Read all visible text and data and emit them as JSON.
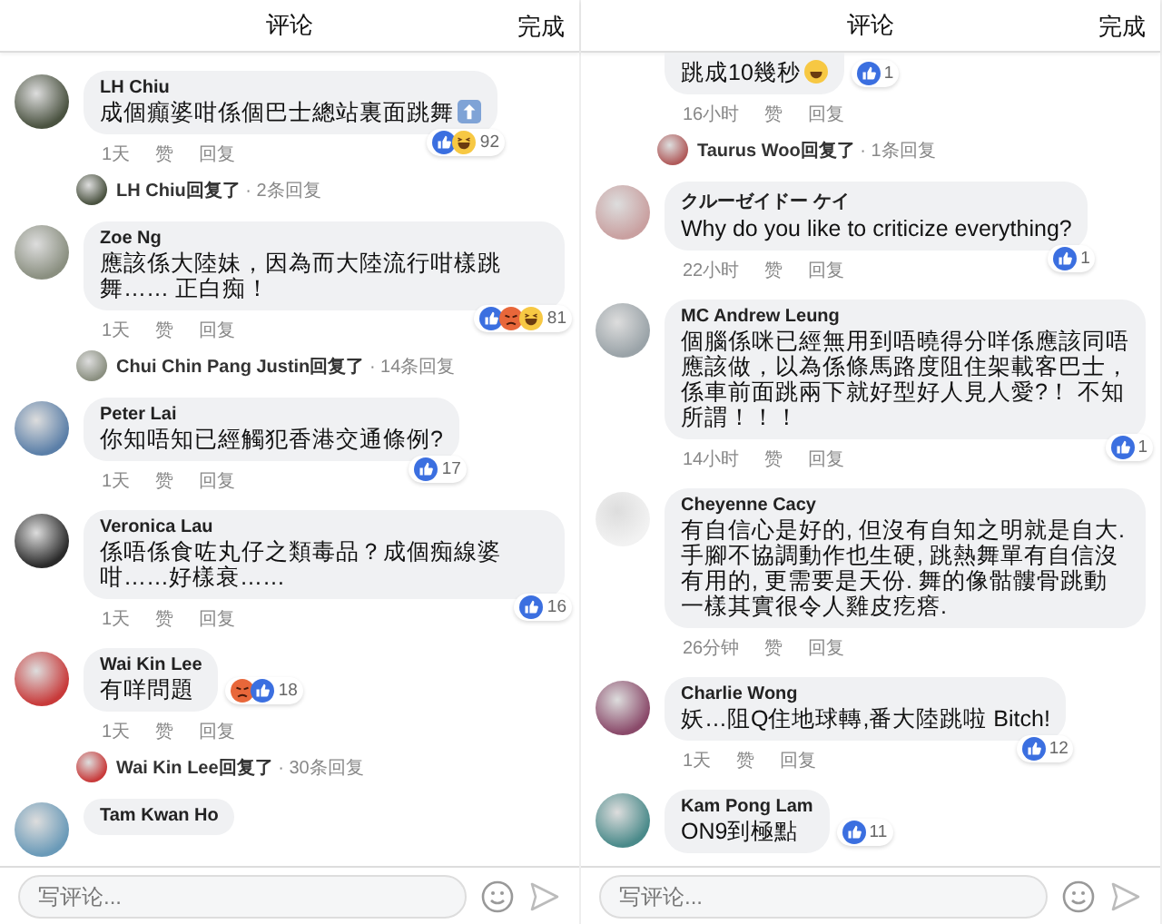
{
  "panels": [
    {
      "header": {
        "title": "评论",
        "done": "完成"
      },
      "comments": [
        {
          "author": "LH Chiu",
          "text": "成個癲婆咁係個巴士總站裏面跳舞",
          "emoji": {
            "kind": "arrow"
          },
          "time": "1天",
          "like": "赞",
          "reply": "回复",
          "reactions": [
            {
              "kind": "like"
            },
            {
              "kind": "haha"
            }
          ],
          "count": "92",
          "replies": "**LH Chiu回复了** · 2条回复"
        },
        {
          "author": "Zoe Ng",
          "text": "應該係大陸妹，因為而大陸流行咁樣跳舞…… 正白痴！",
          "time": "1天",
          "like": "赞",
          "reply": "回复",
          "reactions": [
            {
              "kind": "like"
            },
            {
              "kind": "angry"
            },
            {
              "kind": "haha"
            }
          ],
          "count": "81",
          "replies": "**Chui Chin Pang Justin回复了** · 14条回复"
        },
        {
          "author": "Peter Lai",
          "text": "你知唔知已經觸犯香港交通條例?",
          "time": "1天",
          "like": "赞",
          "reply": "回复",
          "reactions": [
            {
              "kind": "like"
            }
          ],
          "count": "17"
        },
        {
          "author": "Veronica Lau",
          "text": "係唔係食咗丸仔之類毒品？成個痴線婆咁……好樣衰……",
          "time": "1天",
          "like": "赞",
          "reply": "回复",
          "reactions": [
            {
              "kind": "like"
            }
          ],
          "count": "16"
        },
        {
          "author": "Wai Kin Lee",
          "text": "有咩問題",
          "time": "1天",
          "like": "赞",
          "reply": "回复",
          "reactions": [
            {
              "kind": "angry"
            },
            {
              "kind": "like"
            }
          ],
          "count": "18",
          "replies": "**Wai Kin Lee回复了** · 30条回复"
        },
        {
          "author": "Tam Kwan Ho"
        }
      ],
      "composer": {
        "placeholder": "写评论..."
      }
    },
    {
      "header": {
        "title": "评论",
        "done": "完成"
      },
      "comments": [
        {
          "text": "跳成10幾秒",
          "emoji": {
            "kind": "laugh"
          },
          "time": "16小时",
          "like": "赞",
          "reply": "回复",
          "reactions": [
            {
              "kind": "like"
            }
          ],
          "count": "1",
          "replies": "**Taurus Woo回复了** · 1条回复"
        },
        {
          "author": "クルーゼイドー ケイ",
          "text": "Why do you like to criticize everything?",
          "time": "22小时",
          "like": "赞",
          "reply": "回复",
          "reactions": [
            {
              "kind": "like"
            }
          ],
          "count": "1"
        },
        {
          "author": "MC Andrew Leung",
          "text": "個腦係咪已經無用到唔曉得分咩係應該同唔應該做，以為係條馬路度阻住架載客巴士，係車前面跳兩下就好型好人見人愛?！ 不知所謂！！！",
          "time": "14小时",
          "like": "赞",
          "reply": "回复",
          "reactions": [
            {
              "kind": "like"
            }
          ],
          "count": "1"
        },
        {
          "author": "Cheyenne Cacy",
          "text": "有自信心是好的, 但沒有自知之明就是自大. 手腳不協調動作也生硬, 跳熱舞單有自信沒有用的, 更需要是天份. 舞的像骷髏骨跳動一樣其實很令人雞皮疙瘩.",
          "time": "26分钟",
          "like": "赞",
          "reply": "回复"
        },
        {
          "author": "Charlie Wong",
          "text": "妖…阻Q住地球轉,番大陸跳啦 Bitch!",
          "time": "1天",
          "like": "赞",
          "reply": "回复",
          "reactions": [
            {
              "kind": "like"
            }
          ],
          "count": "12"
        },
        {
          "author": "Kam Pong Lam",
          "text": "ON9到極點",
          "reactions": [
            {
              "kind": "like"
            }
          ],
          "count": "11"
        }
      ],
      "composer": {
        "placeholder": "写评论..."
      }
    }
  ]
}
